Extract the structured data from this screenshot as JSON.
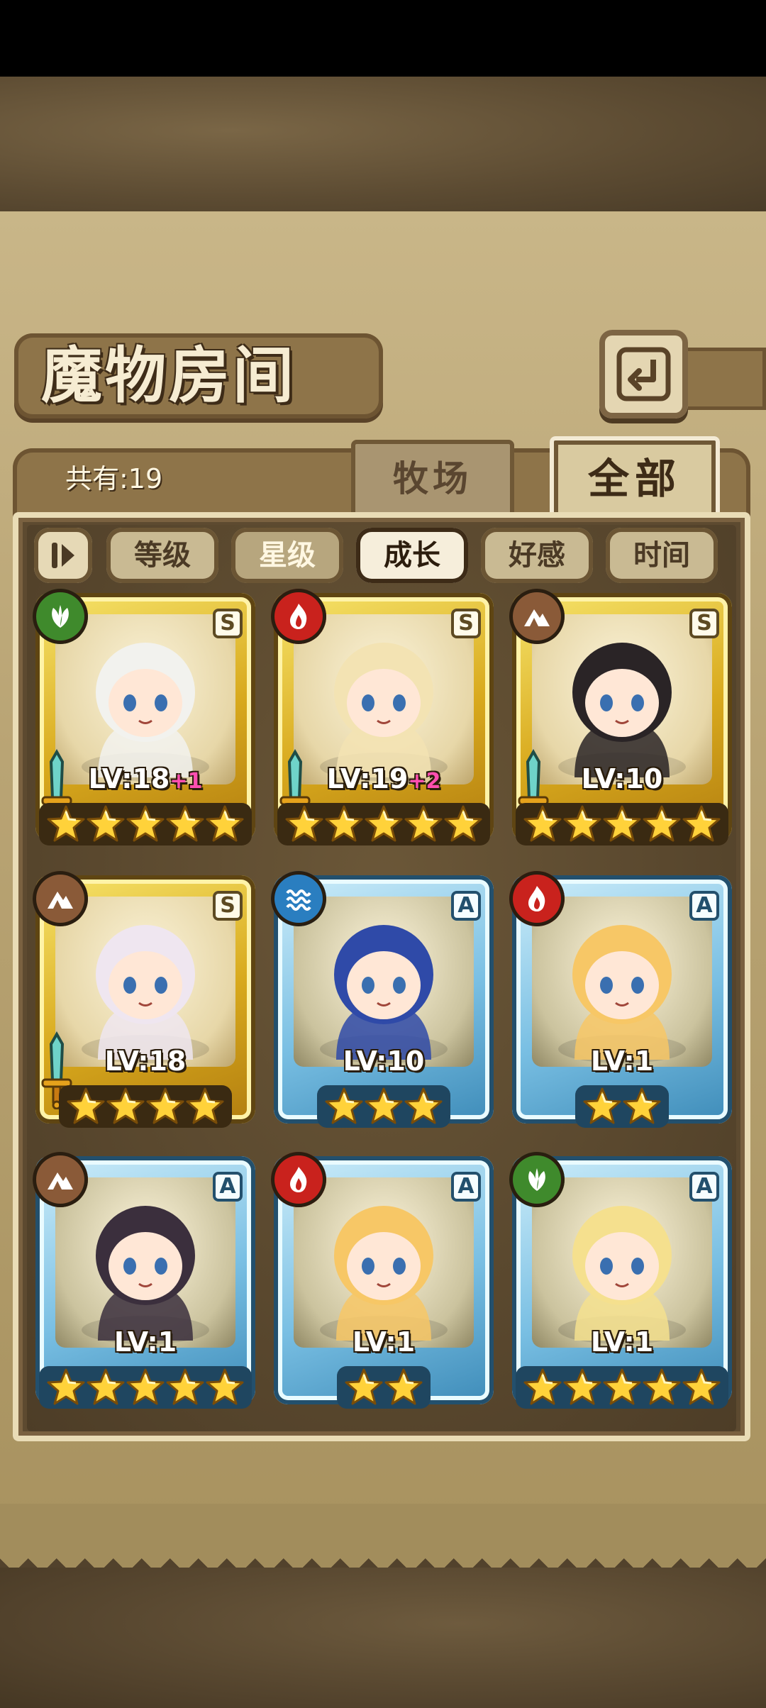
{
  "screen_title": "魔物房间",
  "total_label": "共有:19",
  "tabs": [
    {
      "label": "牧场",
      "active": false
    },
    {
      "label": "全部",
      "active": true
    }
  ],
  "sort_buttons": [
    {
      "label": "等级",
      "state": "normal"
    },
    {
      "label": "星级",
      "state": "dim"
    },
    {
      "label": "成长",
      "state": "active"
    },
    {
      "label": "好感",
      "state": "normal"
    },
    {
      "label": "时间",
      "state": "normal"
    }
  ],
  "icons": {
    "back": "back-arrow-icon",
    "sort_toggle": "sort-order-icon"
  },
  "colors": {
    "gold_frame": "#d8a91d",
    "blue_frame": "#79bfe3",
    "level_bonus": "#ff4fb0",
    "element_wood": "#3f8a2c",
    "element_fire": "#c9221d",
    "element_earth": "#8a5a38",
    "element_water": "#2a7ec0"
  },
  "monsters": [
    {
      "rank": "S",
      "element": "wood",
      "level": "LV:18",
      "bonus": "+1",
      "stars": 5,
      "weapon": true,
      "frame": "gold"
    },
    {
      "rank": "S",
      "element": "fire",
      "level": "LV:19",
      "bonus": "+2",
      "stars": 5,
      "weapon": true,
      "frame": "gold"
    },
    {
      "rank": "S",
      "element": "earth",
      "level": "LV:10",
      "bonus": "",
      "stars": 5,
      "weapon": true,
      "frame": "gold"
    },
    {
      "rank": "S",
      "element": "earth",
      "level": "LV:18",
      "bonus": "",
      "stars": 4,
      "weapon": true,
      "frame": "gold"
    },
    {
      "rank": "A",
      "element": "water",
      "level": "LV:10",
      "bonus": "",
      "stars": 3,
      "weapon": false,
      "frame": "blue"
    },
    {
      "rank": "A",
      "element": "fire",
      "level": "LV:1",
      "bonus": "",
      "stars": 2,
      "weapon": false,
      "frame": "blue"
    },
    {
      "rank": "A",
      "element": "earth",
      "level": "LV:1",
      "bonus": "",
      "stars": 5,
      "weapon": false,
      "frame": "blue"
    },
    {
      "rank": "A",
      "element": "fire",
      "level": "LV:1",
      "bonus": "",
      "stars": 2,
      "weapon": false,
      "frame": "blue"
    },
    {
      "rank": "A",
      "element": "wood",
      "level": "LV:1",
      "bonus": "",
      "stars": 5,
      "weapon": false,
      "frame": "blue"
    }
  ]
}
